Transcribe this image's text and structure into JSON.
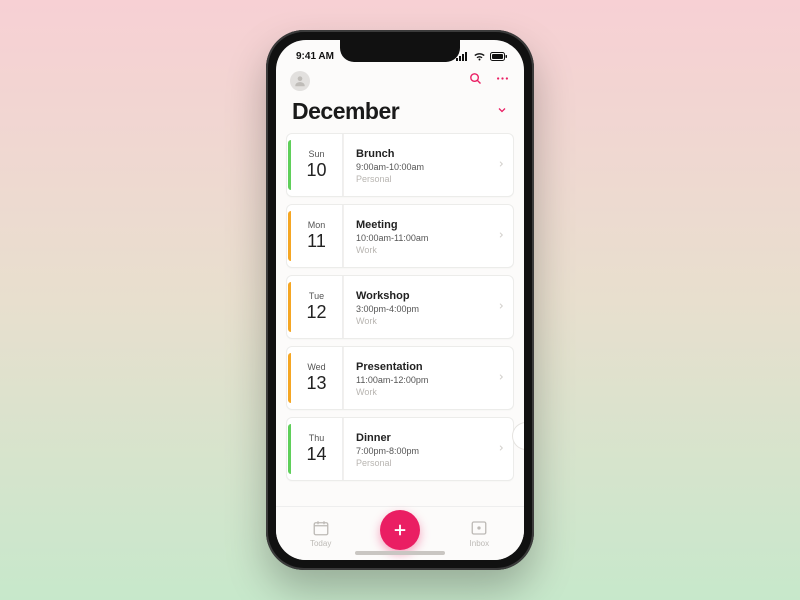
{
  "status": {
    "time": "9:41 AM"
  },
  "title": "December",
  "colors": {
    "accent": "#ea1e63",
    "green": "#5fcf5a",
    "orange": "#f5a623"
  },
  "events": [
    {
      "dow": "Sun",
      "day": "10",
      "title": "Brunch",
      "time": "9:00am-10:00am",
      "cat": "Personal",
      "stripe": "#5fcf5a"
    },
    {
      "dow": "Mon",
      "day": "11",
      "title": "Meeting",
      "time": "10:00am-11:00am",
      "cat": "Work",
      "stripe": "#f5a623"
    },
    {
      "dow": "Tue",
      "day": "12",
      "title": "Workshop",
      "time": "3:00pm-4:00pm",
      "cat": "Work",
      "stripe": "#f5a623"
    },
    {
      "dow": "Wed",
      "day": "13",
      "title": "Presentation",
      "time": "11:00am-12:00pm",
      "cat": "Work",
      "stripe": "#f5a623"
    },
    {
      "dow": "Thu",
      "day": "14",
      "title": "Dinner",
      "time": "7:00pm-8:00pm",
      "cat": "Personal",
      "stripe": "#5fcf5a"
    }
  ],
  "nav": {
    "today": "Today",
    "inbox": "Inbox"
  }
}
